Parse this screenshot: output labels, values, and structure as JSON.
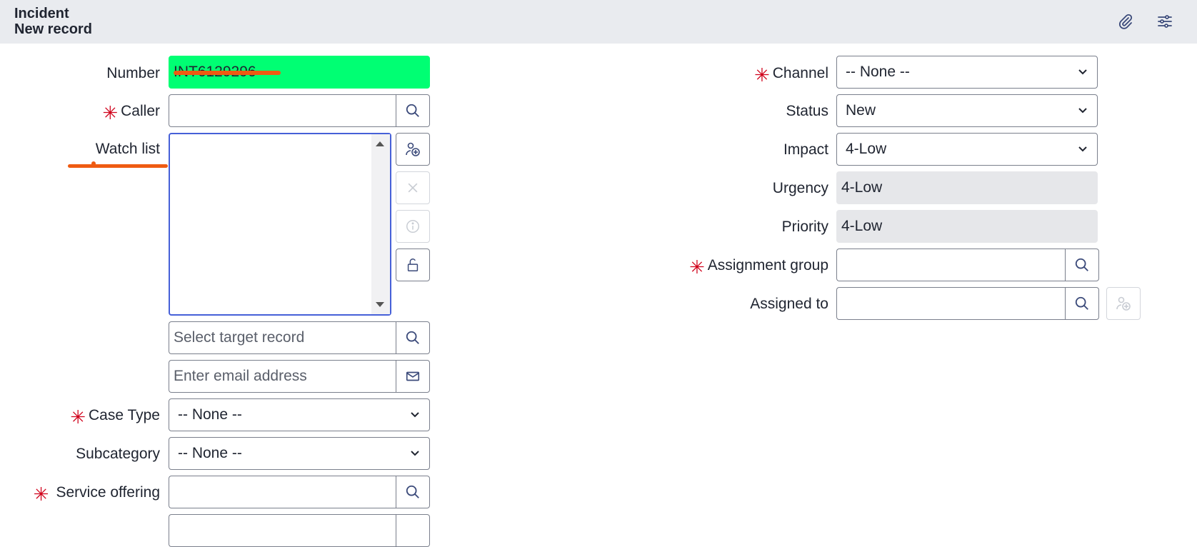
{
  "header": {
    "table_name": "Incident",
    "record_state": "New record",
    "icons": [
      "paperclip-icon",
      "sliders-icon"
    ]
  },
  "colors": {
    "required": "#d0021b",
    "accent": "#4660d8",
    "number_highlight": "#00ff73",
    "annotation": "#ef5b12"
  },
  "left": {
    "number": {
      "label": "Number",
      "value": "INT6129296"
    },
    "caller": {
      "label": "Caller",
      "value": ""
    },
    "watch_list": {
      "label": "Watch list"
    },
    "target_record": {
      "placeholder": "Select target record"
    },
    "email": {
      "placeholder": "Enter email address"
    },
    "case_type": {
      "label": "Case Type",
      "value": "-- None --"
    },
    "subcategory": {
      "label": "Subcategory",
      "value": "-- None --"
    },
    "service_offering": {
      "label": "Service offering",
      "value": ""
    }
  },
  "right": {
    "channel": {
      "label": "Channel",
      "value": "-- None --"
    },
    "status": {
      "label": "Status",
      "value": "New"
    },
    "impact": {
      "label": "Impact",
      "value": "4-Low"
    },
    "urgency": {
      "label": "Urgency",
      "value": "4-Low"
    },
    "priority": {
      "label": "Priority",
      "value": "4-Low"
    },
    "assignment_group": {
      "label": "Assignment group",
      "value": ""
    },
    "assigned_to": {
      "label": "Assigned to",
      "value": ""
    }
  }
}
